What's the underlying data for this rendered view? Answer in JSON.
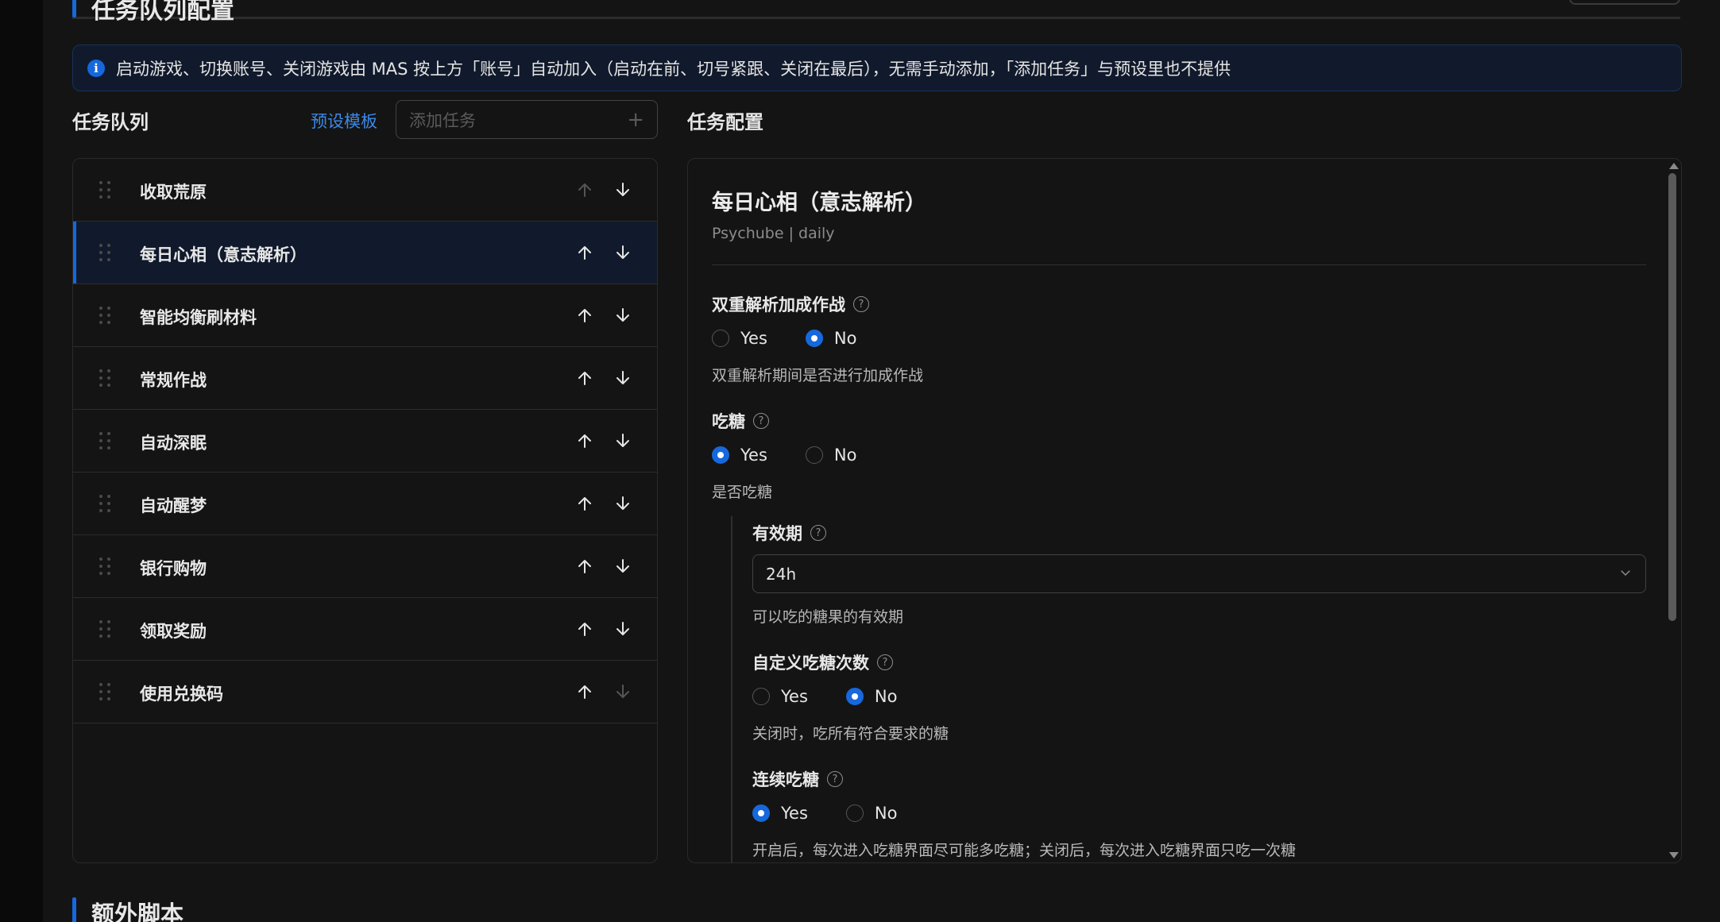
{
  "top_section": {
    "title": "任务队列配置"
  },
  "alert": {
    "text": "启动游戏、切换账号、关闭游戏由 MAS 按上方「账号」自动加入（启动在前、切号紧跟、关闭在最后），无需手动添加，「添加任务」与预设里也不提供"
  },
  "queue": {
    "title": "任务队列",
    "preset_label": "预设模板",
    "add_placeholder": "添加任务",
    "tasks": [
      {
        "label": "收取荒原",
        "active": false,
        "up_enabled": false,
        "down_enabled": true
      },
      {
        "label": "每日心相（意志解析）",
        "active": true,
        "up_enabled": true,
        "down_enabled": true
      },
      {
        "label": "智能均衡刷材料",
        "active": false,
        "up_enabled": true,
        "down_enabled": true
      },
      {
        "label": "常规作战",
        "active": false,
        "up_enabled": true,
        "down_enabled": true
      },
      {
        "label": "自动深眠",
        "active": false,
        "up_enabled": true,
        "down_enabled": true
      },
      {
        "label": "自动醒梦",
        "active": false,
        "up_enabled": true,
        "down_enabled": true
      },
      {
        "label": "银行购物",
        "active": false,
        "up_enabled": true,
        "down_enabled": true
      },
      {
        "label": "领取奖励",
        "active": false,
        "up_enabled": true,
        "down_enabled": true
      },
      {
        "label": "使用兑换码",
        "active": false,
        "up_enabled": true,
        "down_enabled": false
      }
    ]
  },
  "config": {
    "title": "任务配置",
    "heading": "每日心相（意志解析）",
    "subtitle": "Psychube | daily",
    "fields": {
      "double_parse": {
        "label": "双重解析加成作战",
        "yes": "Yes",
        "no": "No",
        "value": "No",
        "desc": "双重解析期间是否进行加成作战"
      },
      "eat_candy": {
        "label": "吃糖",
        "yes": "Yes",
        "no": "No",
        "value": "Yes",
        "desc": "是否吃糖"
      },
      "validity": {
        "label": "有效期",
        "value": "24h",
        "desc": "可以吃的糖果的有效期"
      },
      "custom_count": {
        "label": "自定义吃糖次数",
        "yes": "Yes",
        "no": "No",
        "value": "No",
        "desc": "关闭时，吃所有符合要求的糖"
      },
      "continuous": {
        "label": "连续吃糖",
        "yes": "Yes",
        "no": "No",
        "value": "Yes",
        "desc": "开启后，每次进入吃糖界面尽可能多吃糖；关闭后，每次进入吃糖界面只吃一次糖"
      }
    }
  },
  "bottom_section": {
    "title": "额外脚本"
  },
  "colors": {
    "accent": "#1668dc",
    "link": "#3c89e8",
    "background": "#141414"
  }
}
